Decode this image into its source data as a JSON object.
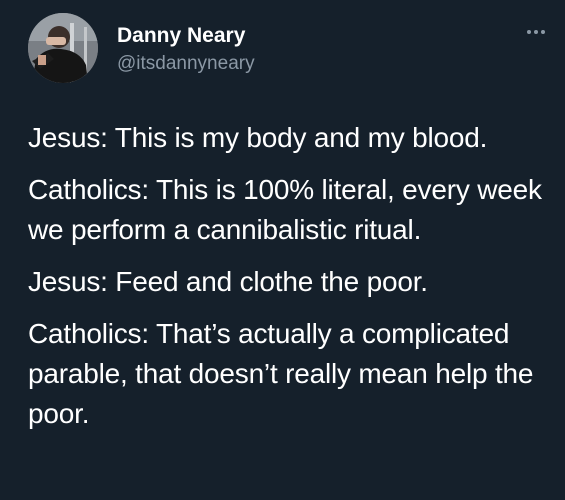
{
  "user": {
    "display_name": "Danny Neary",
    "handle": "@itsdannyneary"
  },
  "menu": {
    "icon": "more-horizontal-icon"
  },
  "tweet": {
    "paragraphs": [
      "Jesus: This is my body and my blood.",
      "Catholics: This is 100% literal, every week we perform a cannibalistic ritual.",
      "Jesus: Feed and clothe the poor.",
      "Catholics: That’s actually a complicated parable, that doesn’t really mean help the poor."
    ]
  },
  "colors": {
    "background": "#15202b",
    "text_primary": "#ffffff",
    "text_secondary": "#8b98a5"
  }
}
